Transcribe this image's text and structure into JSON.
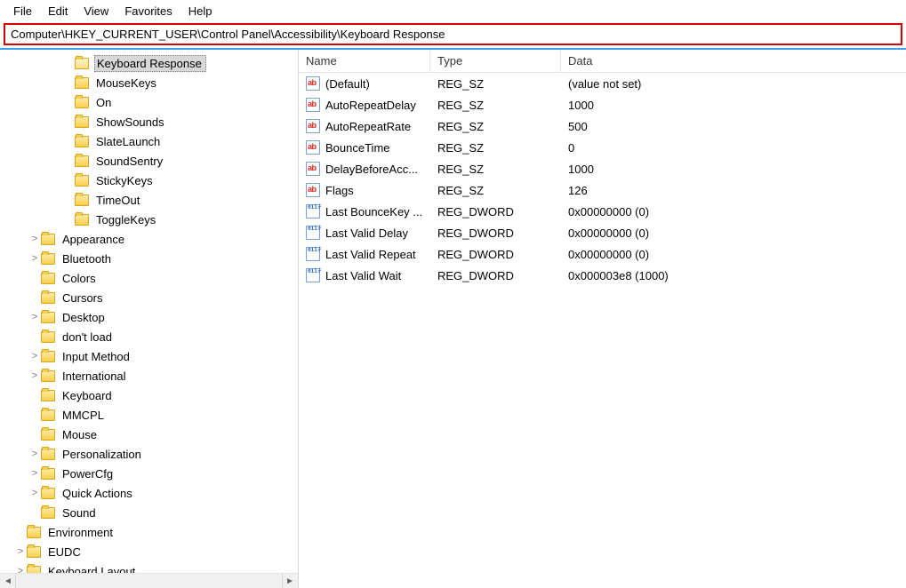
{
  "menu": {
    "file": "File",
    "edit": "Edit",
    "view": "View",
    "favorites": "Favorites",
    "help": "Help"
  },
  "address": "Computer\\HKEY_CURRENT_USER\\Control Panel\\Accessibility\\Keyboard Response",
  "tree": {
    "level3": [
      {
        "label": "Keyboard Response",
        "selected": true,
        "open": true
      },
      {
        "label": "MouseKeys"
      },
      {
        "label": "On"
      },
      {
        "label": "ShowSounds"
      },
      {
        "label": "SlateLaunch"
      },
      {
        "label": "SoundSentry"
      },
      {
        "label": "StickyKeys"
      },
      {
        "label": "TimeOut"
      },
      {
        "label": "ToggleKeys"
      }
    ],
    "level2": [
      {
        "label": "Appearance",
        "expander": ">"
      },
      {
        "label": "Bluetooth",
        "expander": ">"
      },
      {
        "label": "Colors"
      },
      {
        "label": "Cursors"
      },
      {
        "label": "Desktop",
        "expander": ">"
      },
      {
        "label": "don't load"
      },
      {
        "label": "Input Method",
        "expander": ">"
      },
      {
        "label": "International",
        "expander": ">"
      },
      {
        "label": "Keyboard"
      },
      {
        "label": "MMCPL"
      },
      {
        "label": "Mouse"
      },
      {
        "label": "Personalization",
        "expander": ">"
      },
      {
        "label": "PowerCfg",
        "expander": ">"
      },
      {
        "label": "Quick Actions",
        "expander": ">"
      },
      {
        "label": "Sound"
      }
    ],
    "level1": [
      {
        "label": "Environment"
      },
      {
        "label": "EUDC",
        "expander": ">"
      },
      {
        "label": "Keyboard Layout",
        "expander": ">"
      }
    ]
  },
  "columns": {
    "name": "Name",
    "type": "Type",
    "data": "Data"
  },
  "values": [
    {
      "icon": "sz",
      "name": "(Default)",
      "type": "REG_SZ",
      "data": "(value not set)"
    },
    {
      "icon": "sz",
      "name": "AutoRepeatDelay",
      "type": "REG_SZ",
      "data": "1000"
    },
    {
      "icon": "sz",
      "name": "AutoRepeatRate",
      "type": "REG_SZ",
      "data": "500"
    },
    {
      "icon": "sz",
      "name": "BounceTime",
      "type": "REG_SZ",
      "data": "0"
    },
    {
      "icon": "sz",
      "name": "DelayBeforeAcc...",
      "type": "REG_SZ",
      "data": "1000"
    },
    {
      "icon": "sz",
      "name": "Flags",
      "type": "REG_SZ",
      "data": "126"
    },
    {
      "icon": "dw",
      "name": "Last BounceKey ...",
      "type": "REG_DWORD",
      "data": "0x00000000 (0)"
    },
    {
      "icon": "dw",
      "name": "Last Valid Delay",
      "type": "REG_DWORD",
      "data": "0x00000000 (0)"
    },
    {
      "icon": "dw",
      "name": "Last Valid Repeat",
      "type": "REG_DWORD",
      "data": "0x00000000 (0)"
    },
    {
      "icon": "dw",
      "name": "Last Valid Wait",
      "type": "REG_DWORD",
      "data": "0x000003e8 (1000)"
    }
  ]
}
